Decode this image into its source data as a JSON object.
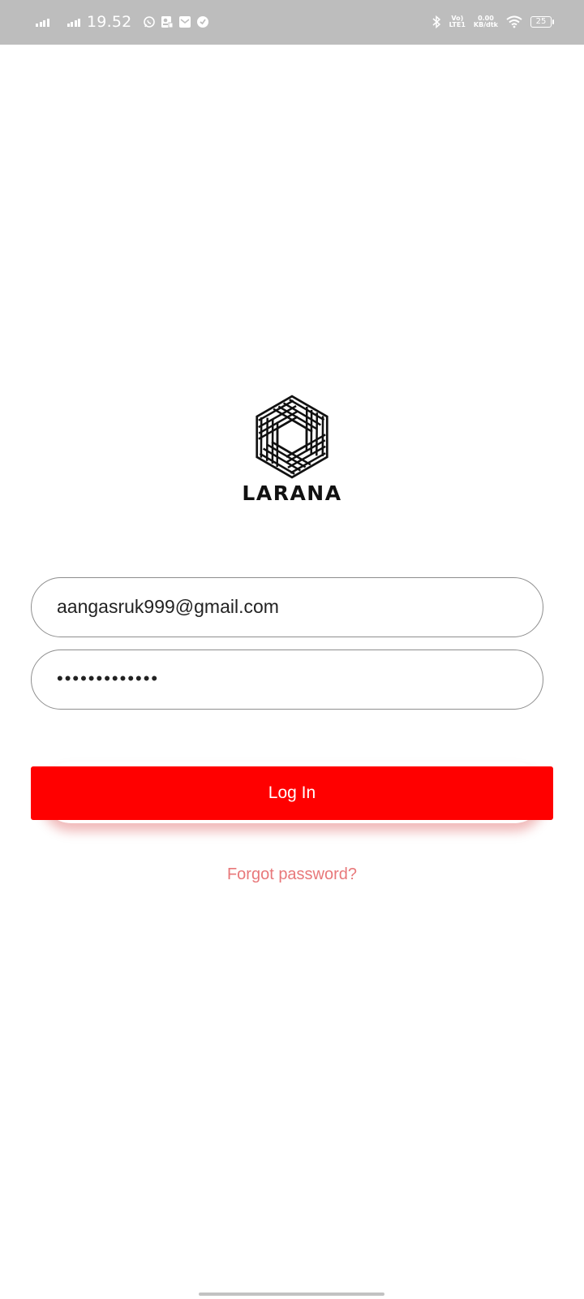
{
  "status_bar": {
    "time": "19.52",
    "network_labels": [
      "Vo)",
      "LTE1"
    ],
    "data_speed": [
      "0.00",
      "KB/dtk"
    ],
    "battery": "25",
    "icons": [
      "signal-icon",
      "signal-icon",
      "whatsapp-icon",
      "notification-icon",
      "mail-icon",
      "app-icon",
      "bluetooth-icon",
      "volte-icon",
      "wifi-icon",
      "battery-icon"
    ]
  },
  "brand": {
    "name": "LARANA"
  },
  "login_form": {
    "email_value": "aangasruk999@gmail.com",
    "password_value": "•••••••••••••",
    "login_label": "Log In",
    "forgot_label": "Forgot password?"
  },
  "colors": {
    "primary": "#ff0000",
    "link": "#e8787a",
    "status_bar_bg": "#bdbdbd"
  }
}
